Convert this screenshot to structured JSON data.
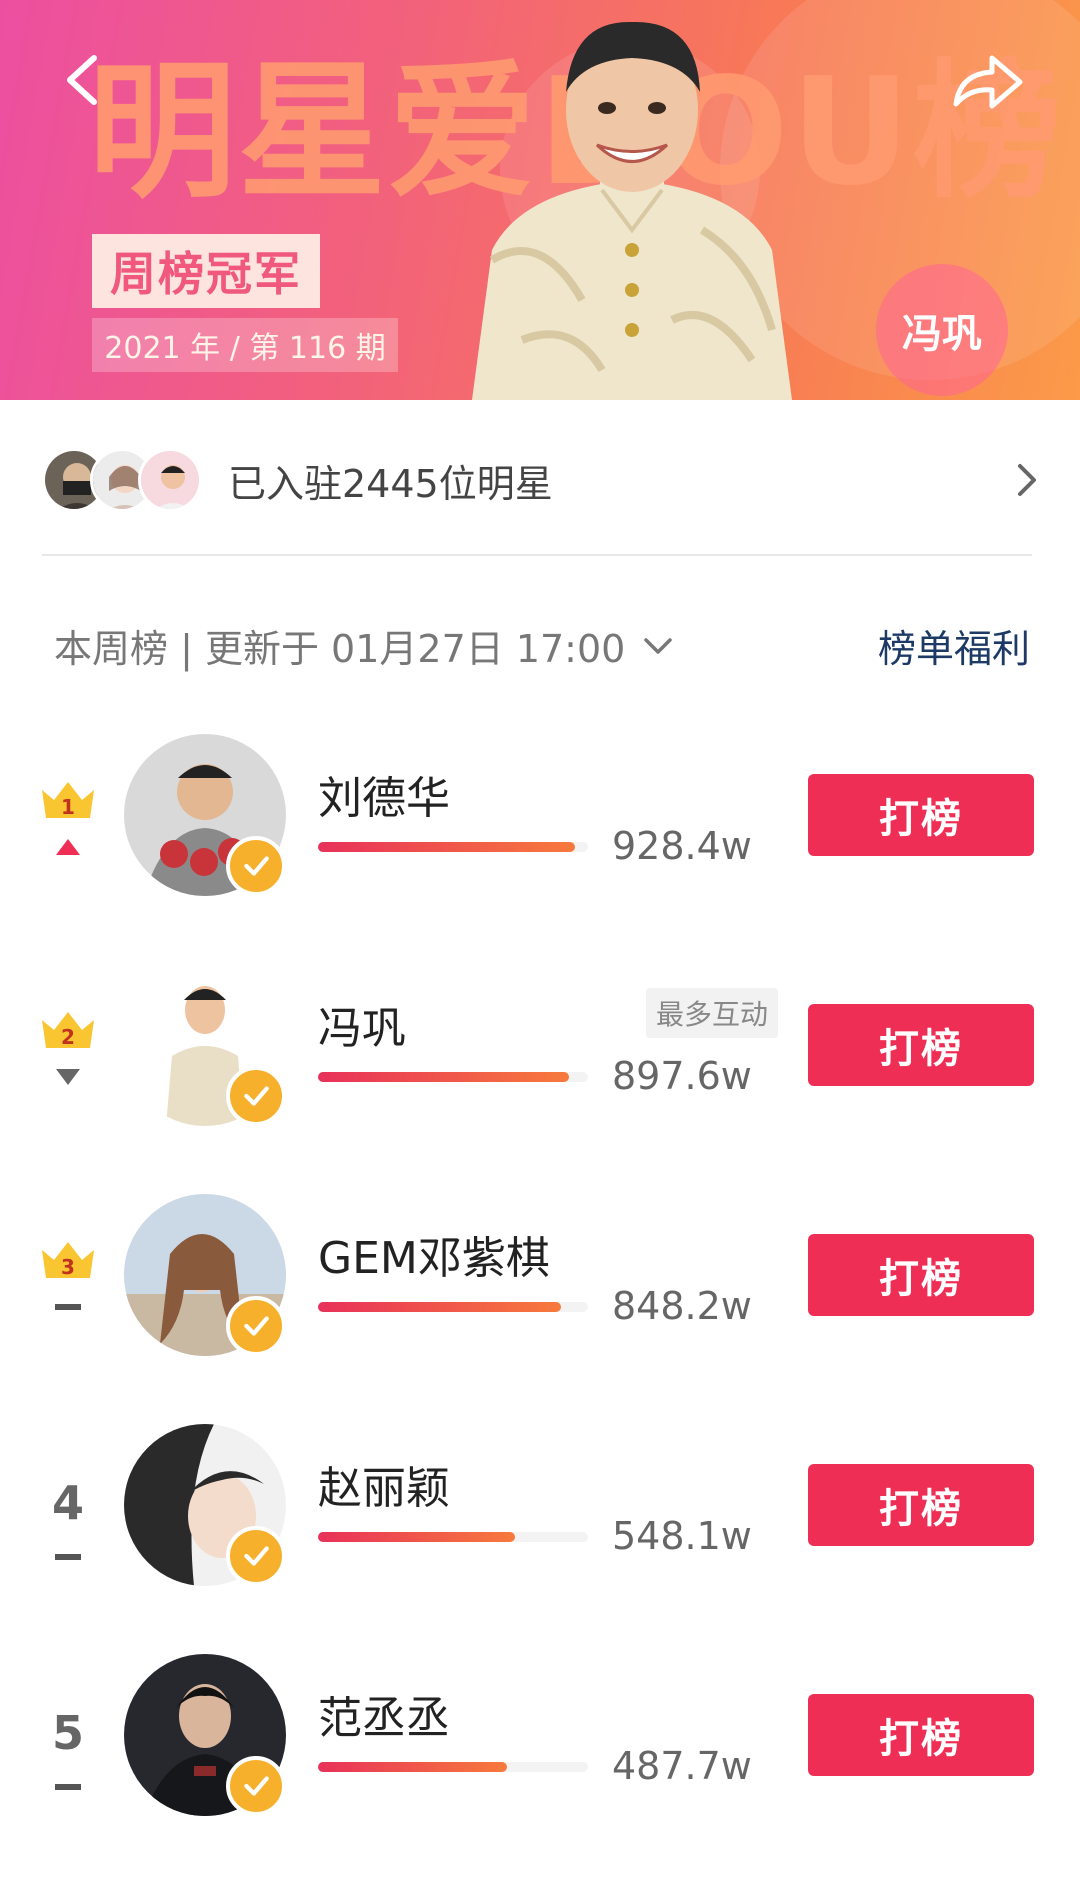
{
  "banner": {
    "title": "明星爱DOU榜",
    "champion_label": "周榜冠军",
    "period": "2021 年 / 第 116 期",
    "champion_name": "冯巩"
  },
  "joined": {
    "text": "已入驻2445位明星"
  },
  "week": {
    "label": "本周榜 | 更新于 01月27日 17:00",
    "benefit": "榜单福利"
  },
  "ranking": [
    {
      "rank": "1",
      "name": "刘德华",
      "score": "928.4w",
      "progress": 0.95,
      "trend": "up",
      "button": "打榜",
      "tag": ""
    },
    {
      "rank": "2",
      "name": "冯巩",
      "score": "897.6w",
      "progress": 0.93,
      "trend": "down",
      "button": "打榜",
      "tag": "最多互动"
    },
    {
      "rank": "3",
      "name": "GEM邓紫棋",
      "score": "848.2w",
      "progress": 0.9,
      "trend": "same",
      "button": "打榜",
      "tag": ""
    },
    {
      "rank": "4",
      "name": "赵丽颖",
      "score": "548.1w",
      "progress": 0.73,
      "trend": "same",
      "button": "打榜",
      "tag": ""
    },
    {
      "rank": "5",
      "name": "范丞丞",
      "score": "487.7w",
      "progress": 0.7,
      "trend": "same",
      "button": "打榜",
      "tag": ""
    }
  ],
  "colors": {
    "accent": "#ef2e55",
    "verify": "#f7b02b",
    "crown": "#f9c531",
    "link": "#1d3a66"
  },
  "icons": [
    "back-icon",
    "share-icon",
    "chevron-right-icon",
    "chevron-down-icon",
    "crown-icon",
    "trend-up-icon",
    "trend-down-icon",
    "verified-icon"
  ]
}
